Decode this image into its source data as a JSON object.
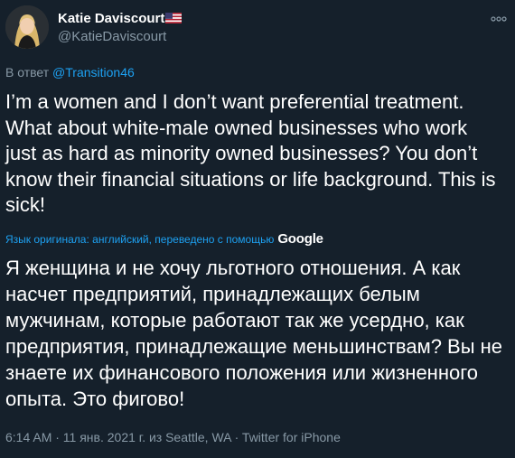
{
  "author": {
    "display_name": "Katie Daviscourt",
    "handle": "@KatieDaviscourt",
    "flag_icon": "us-flag-icon"
  },
  "reply": {
    "prefix": "В ответ",
    "mention": "@Transition46"
  },
  "tweet": {
    "text": "I’m a women and I don’t want preferential treatment.\nWhat about white-male owned businesses who work\njust as hard as minority owned businesses? You don’t\nknow their financial situations or life background. This is\nsick!",
    "translation_note": "Язык оригинала: английский, переведено с помощью",
    "translation_provider": "Google",
    "translated_text": "Я женщина и не хочу льготного отношения. А как\nнасчет предприятий, принадлежащих белым\nмужчинам, которые работают так же усердно, как\nпредприятия, принадлежащие меньшинствам? Вы не\nзнаете их финансового положения или жизненного\nопыта. Это фигово!",
    "meta": "6:14 AM · 11 янв. 2021 г. из Seattle, WA · Twitter for iPhone"
  },
  "colors": {
    "background": "#15202b",
    "text": "#ffffff",
    "secondary": "#8899a6",
    "link": "#1da1f2"
  }
}
